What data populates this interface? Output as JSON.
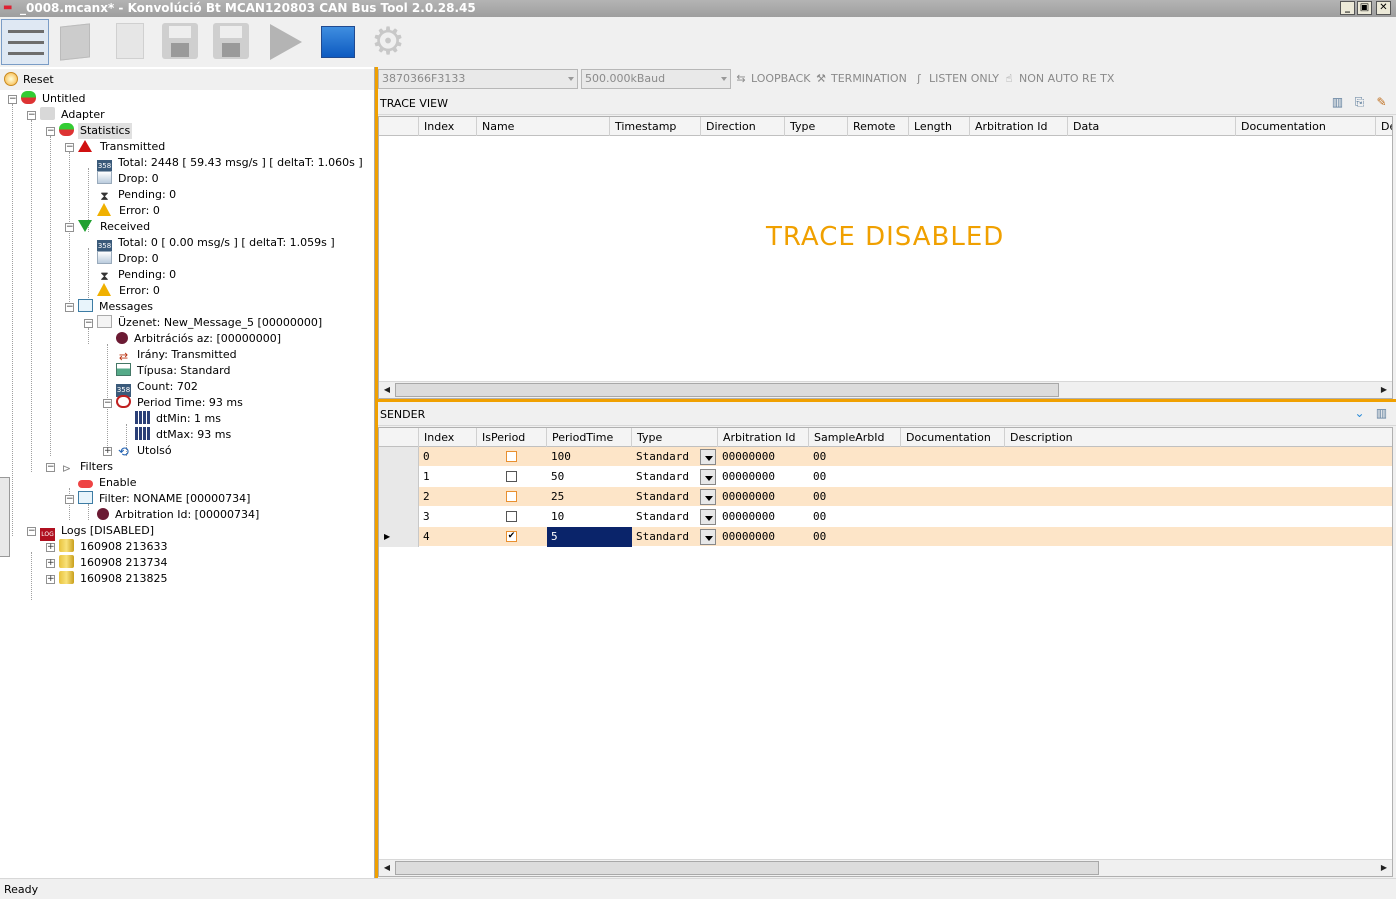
{
  "window": {
    "title": "_0008.mcanx* - Konvolúció Bt MCAN120803 CAN Bus Tool 2.0.28.45",
    "min": "_",
    "max": "▣",
    "close": "✕"
  },
  "toolbar": {
    "icons": [
      "menu-icon",
      "open-folder-icon",
      "new-file-icon",
      "save-icon",
      "save-as-icon",
      "play-icon",
      "stop-icon",
      "settings-gear-icon"
    ]
  },
  "left": {
    "reset_label": "Reset"
  },
  "tree": {
    "root": "Untitled",
    "adapter": "Adapter",
    "statistics": "Statistics",
    "transmitted": "Transmitted",
    "tx_total": "Total: 2448 [ 59.43 msg/s ]  [ deltaT: 1.060s ]",
    "tx_drop": "Drop: 0",
    "tx_pending": "Pending: 0",
    "tx_error": "Error: 0",
    "received": "Received",
    "rx_total": "Total: 0 [ 0.00 msg/s ]  [ deltaT: 1.059s ]",
    "rx_drop": "Drop: 0",
    "rx_pending": "Pending: 0",
    "rx_error": "Error: 0",
    "messages": "Messages",
    "message": "Üzenet: New_Message_5 [00000000]",
    "arb": "Arbitrációs az: [00000000]",
    "dir": "Irány: Transmitted",
    "type": "Típusa: Standard",
    "count": "Count: 702",
    "period": "Period Time: 93 ms",
    "dtmin": "dtMin: 1 ms",
    "dtmax": "dtMax: 93 ms",
    "last": "Utolsó",
    "filters": "Filters",
    "enable": "Enable",
    "filter": "Filter: NONAME [00000734]",
    "filter_arb": "Arbitration Id: [00000734]",
    "logs": "Logs [DISABLED]",
    "log1": "160908 213633",
    "log2": "160908 213734",
    "log3": "160908 213825"
  },
  "connection": {
    "device": "3870366F3133",
    "baud": "500.000kBaud",
    "loopback": "LOOPBACK",
    "termination": "TERMINATION",
    "listen_only": "LISTEN ONLY",
    "non_auto_re_tx": "NON AUTO RE TX"
  },
  "trace": {
    "title": "TRACE VIEW",
    "columns": [
      "Index",
      "Name",
      "Timestamp",
      "Direction",
      "Type",
      "Remote",
      "Length",
      "Arbitration Id",
      "Data",
      "Documentation",
      "De"
    ],
    "disabled_text": "TRACE DISABLED"
  },
  "sender": {
    "title": "SENDER",
    "columns": [
      "Index",
      "IsPeriod",
      "PeriodTime",
      "Type",
      "Arbitration Id",
      "SampleArbId",
      "Documentation",
      "Description"
    ],
    "rows": [
      {
        "index": "0",
        "is_period": false,
        "period_time": "100",
        "type": "Standard",
        "arb_id": "00000000",
        "sample": "00"
      },
      {
        "index": "1",
        "is_period": false,
        "period_time": "50",
        "type": "Standard",
        "arb_id": "00000000",
        "sample": "00"
      },
      {
        "index": "2",
        "is_period": false,
        "period_time": "25",
        "type": "Standard",
        "arb_id": "00000000",
        "sample": "00"
      },
      {
        "index": "3",
        "is_period": false,
        "period_time": "10",
        "type": "Standard",
        "arb_id": "00000000",
        "sample": "00"
      },
      {
        "index": "4",
        "is_period": true,
        "period_time": "5",
        "type": "Standard",
        "arb_id": "00000000",
        "sample": "00",
        "selected": true
      }
    ]
  },
  "status": {
    "text": "Ready"
  },
  "colors": {
    "accent_orange": "#f0a000",
    "row_highlight": "#fde5c8",
    "selected_cell": "#0a246a",
    "stop_blue": "#1a6ad0"
  }
}
